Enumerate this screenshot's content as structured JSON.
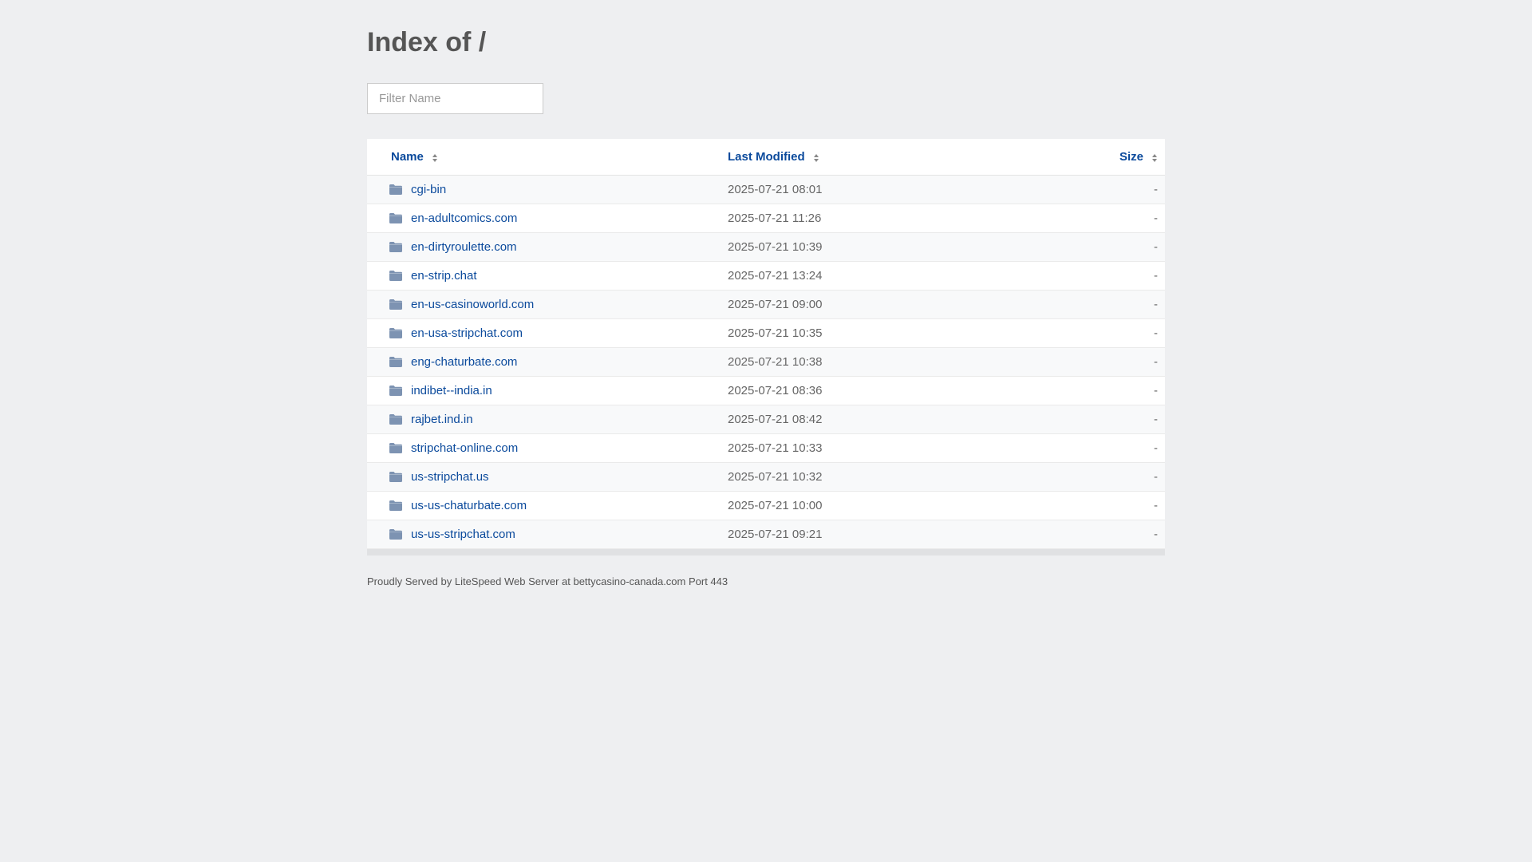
{
  "page": {
    "title": "Index of /"
  },
  "filter": {
    "placeholder": "Filter Name",
    "value": ""
  },
  "table": {
    "headers": {
      "name": "Name",
      "modified": "Last Modified",
      "size": "Size"
    },
    "rows": [
      {
        "name": "cgi-bin",
        "modified": "2025-07-21 08:01",
        "size": "-"
      },
      {
        "name": "en-adultcomics.com",
        "modified": "2025-07-21 11:26",
        "size": "-"
      },
      {
        "name": "en-dirtyroulette.com",
        "modified": "2025-07-21 10:39",
        "size": "-"
      },
      {
        "name": "en-strip.chat",
        "modified": "2025-07-21 13:24",
        "size": "-"
      },
      {
        "name": "en-us-casinoworld.com",
        "modified": "2025-07-21 09:00",
        "size": "-"
      },
      {
        "name": "en-usa-stripchat.com",
        "modified": "2025-07-21 10:35",
        "size": "-"
      },
      {
        "name": "eng-chaturbate.com",
        "modified": "2025-07-21 10:38",
        "size": "-"
      },
      {
        "name": "indibet--india.in",
        "modified": "2025-07-21 08:36",
        "size": "-"
      },
      {
        "name": "rajbet.ind.in",
        "modified": "2025-07-21 08:42",
        "size": "-"
      },
      {
        "name": "stripchat-online.com",
        "modified": "2025-07-21 10:33",
        "size": "-"
      },
      {
        "name": "us-stripchat.us",
        "modified": "2025-07-21 10:32",
        "size": "-"
      },
      {
        "name": "us-us-chaturbate.com",
        "modified": "2025-07-21 10:00",
        "size": "-"
      },
      {
        "name": "us-us-stripchat.com",
        "modified": "2025-07-21 09:21",
        "size": "-"
      }
    ]
  },
  "footer": {
    "text": "Proudly Served by LiteSpeed Web Server at bettycasino-canada.com Port 443"
  },
  "colors": {
    "background": "#eeeff1",
    "link": "#0b4a9c",
    "folder_icon": "#7d93b2"
  },
  "icons": {
    "folder": "folder-icon",
    "sort": "sort-icon"
  }
}
